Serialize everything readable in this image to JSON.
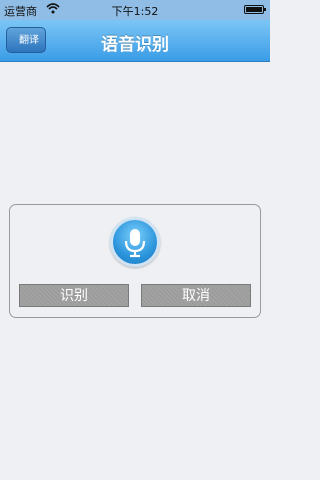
{
  "status_bar": {
    "carrier": "运营商",
    "time": "下午1:52"
  },
  "nav": {
    "back_label": "翻译",
    "title": "语音识别"
  },
  "panel": {
    "recognize_label": "识别",
    "cancel_label": "取消"
  },
  "icons": {
    "wifi": "wifi-icon",
    "battery": "battery-icon",
    "mic": "microphone-icon"
  },
  "colors": {
    "nav_top": "#7cc6f6",
    "nav_bottom": "#3a9de6",
    "mic_blue": "#2b95dc",
    "button_gray": "#9c9c9c",
    "background": "#eef0f4"
  }
}
